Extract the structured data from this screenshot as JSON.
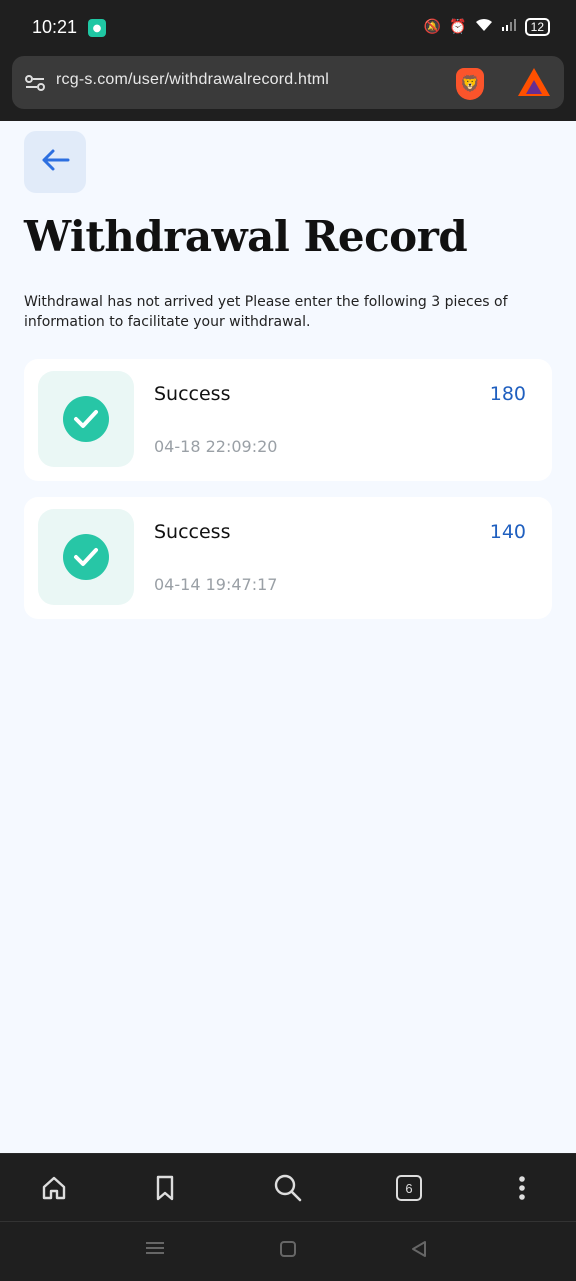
{
  "status_bar": {
    "time": "10:21",
    "battery": "12",
    "icons": [
      "app-notification-icon",
      "silent-icon",
      "alarm-icon",
      "wifi-icon",
      "signal-icon",
      "battery-icon"
    ]
  },
  "browser": {
    "url": "rcg-s.com/user/withdrawalrecord.html",
    "tab_count": "6"
  },
  "page": {
    "title": "Withdrawal Record",
    "notice": "Withdrawal has not arrived yet Please enter the following 3 pieces of information to facilitate your withdrawal."
  },
  "records": [
    {
      "status": "Success",
      "amount": "180",
      "time": "04-18 22:09:20"
    },
    {
      "status": "Success",
      "amount": "140",
      "time": "04-14 19:47:17"
    }
  ],
  "colors": {
    "accent": "#1f5fbf",
    "success": "#27c6a6",
    "page_bg": "#f5f9ff"
  }
}
